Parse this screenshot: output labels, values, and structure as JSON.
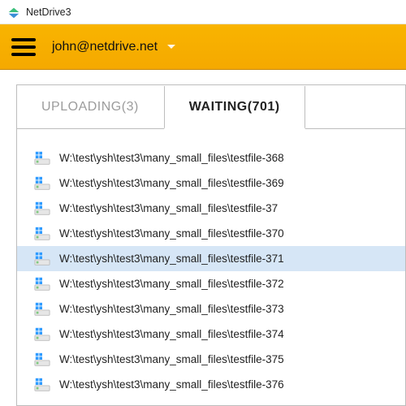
{
  "window": {
    "title": "NetDrive3"
  },
  "header": {
    "account_email": "john@netdrive.net"
  },
  "tabs": {
    "uploading": {
      "label": "UPLOADING",
      "count": 3
    },
    "waiting": {
      "label": "WAITING",
      "count": 701
    },
    "active": "waiting"
  },
  "list": {
    "selected_index": 4,
    "items": [
      {
        "path": "W:\\test\\ysh\\test3\\many_small_files\\testfile-368"
      },
      {
        "path": "W:\\test\\ysh\\test3\\many_small_files\\testfile-369"
      },
      {
        "path": "W:\\test\\ysh\\test3\\many_small_files\\testfile-37"
      },
      {
        "path": "W:\\test\\ysh\\test3\\many_small_files\\testfile-370"
      },
      {
        "path": "W:\\test\\ysh\\test3\\many_small_files\\testfile-371"
      },
      {
        "path": "W:\\test\\ysh\\test3\\many_small_files\\testfile-372"
      },
      {
        "path": "W:\\test\\ysh\\test3\\many_small_files\\testfile-373"
      },
      {
        "path": "W:\\test\\ysh\\test3\\many_small_files\\testfile-374"
      },
      {
        "path": "W:\\test\\ysh\\test3\\many_small_files\\testfile-375"
      },
      {
        "path": "W:\\test\\ysh\\test3\\many_small_files\\testfile-376"
      }
    ]
  }
}
